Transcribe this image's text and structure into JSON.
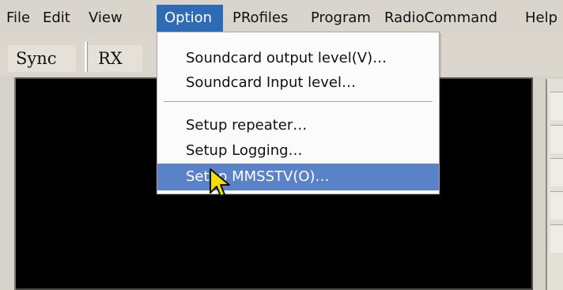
{
  "menubar": {
    "items": [
      "File",
      "Edit",
      "View",
      "Option",
      "PRofiles",
      "Program",
      "RadioCommand",
      "Help"
    ]
  },
  "tabs": [
    {
      "label": "Sync"
    },
    {
      "label": "RX"
    }
  ],
  "dropdown": {
    "items": [
      {
        "label": "Soundcard output level(V)…"
      },
      {
        "label": "Soundcard Input level…"
      },
      {
        "label": "Setup repeater…"
      },
      {
        "label": "Setup Logging…"
      },
      {
        "label": "Setup MMSSTV(O)…"
      }
    ]
  },
  "colors": {
    "menu_bg": "#d9d5cd",
    "selected_menu": "#2f6ab4",
    "dropdown_highlight": "#5a82c8",
    "dropdown_bg": "#fbfbfb",
    "display_bg": "#000000"
  }
}
